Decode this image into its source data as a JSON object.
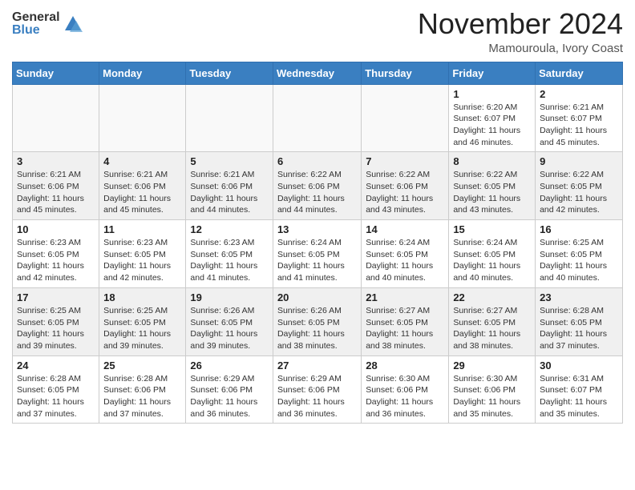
{
  "logo": {
    "general": "General",
    "blue": "Blue"
  },
  "title": "November 2024",
  "location": "Mamouroula, Ivory Coast",
  "headers": [
    "Sunday",
    "Monday",
    "Tuesday",
    "Wednesday",
    "Thursday",
    "Friday",
    "Saturday"
  ],
  "weeks": [
    [
      {
        "day": "",
        "info": ""
      },
      {
        "day": "",
        "info": ""
      },
      {
        "day": "",
        "info": ""
      },
      {
        "day": "",
        "info": ""
      },
      {
        "day": "",
        "info": ""
      },
      {
        "day": "1",
        "info": "Sunrise: 6:20 AM\nSunset: 6:07 PM\nDaylight: 11 hours\nand 46 minutes."
      },
      {
        "day": "2",
        "info": "Sunrise: 6:21 AM\nSunset: 6:07 PM\nDaylight: 11 hours\nand 45 minutes."
      }
    ],
    [
      {
        "day": "3",
        "info": "Sunrise: 6:21 AM\nSunset: 6:06 PM\nDaylight: 11 hours\nand 45 minutes."
      },
      {
        "day": "4",
        "info": "Sunrise: 6:21 AM\nSunset: 6:06 PM\nDaylight: 11 hours\nand 45 minutes."
      },
      {
        "day": "5",
        "info": "Sunrise: 6:21 AM\nSunset: 6:06 PM\nDaylight: 11 hours\nand 44 minutes."
      },
      {
        "day": "6",
        "info": "Sunrise: 6:22 AM\nSunset: 6:06 PM\nDaylight: 11 hours\nand 44 minutes."
      },
      {
        "day": "7",
        "info": "Sunrise: 6:22 AM\nSunset: 6:06 PM\nDaylight: 11 hours\nand 43 minutes."
      },
      {
        "day": "8",
        "info": "Sunrise: 6:22 AM\nSunset: 6:05 PM\nDaylight: 11 hours\nand 43 minutes."
      },
      {
        "day": "9",
        "info": "Sunrise: 6:22 AM\nSunset: 6:05 PM\nDaylight: 11 hours\nand 42 minutes."
      }
    ],
    [
      {
        "day": "10",
        "info": "Sunrise: 6:23 AM\nSunset: 6:05 PM\nDaylight: 11 hours\nand 42 minutes."
      },
      {
        "day": "11",
        "info": "Sunrise: 6:23 AM\nSunset: 6:05 PM\nDaylight: 11 hours\nand 42 minutes."
      },
      {
        "day": "12",
        "info": "Sunrise: 6:23 AM\nSunset: 6:05 PM\nDaylight: 11 hours\nand 41 minutes."
      },
      {
        "day": "13",
        "info": "Sunrise: 6:24 AM\nSunset: 6:05 PM\nDaylight: 11 hours\nand 41 minutes."
      },
      {
        "day": "14",
        "info": "Sunrise: 6:24 AM\nSunset: 6:05 PM\nDaylight: 11 hours\nand 40 minutes."
      },
      {
        "day": "15",
        "info": "Sunrise: 6:24 AM\nSunset: 6:05 PM\nDaylight: 11 hours\nand 40 minutes."
      },
      {
        "day": "16",
        "info": "Sunrise: 6:25 AM\nSunset: 6:05 PM\nDaylight: 11 hours\nand 40 minutes."
      }
    ],
    [
      {
        "day": "17",
        "info": "Sunrise: 6:25 AM\nSunset: 6:05 PM\nDaylight: 11 hours\nand 39 minutes."
      },
      {
        "day": "18",
        "info": "Sunrise: 6:25 AM\nSunset: 6:05 PM\nDaylight: 11 hours\nand 39 minutes."
      },
      {
        "day": "19",
        "info": "Sunrise: 6:26 AM\nSunset: 6:05 PM\nDaylight: 11 hours\nand 39 minutes."
      },
      {
        "day": "20",
        "info": "Sunrise: 6:26 AM\nSunset: 6:05 PM\nDaylight: 11 hours\nand 38 minutes."
      },
      {
        "day": "21",
        "info": "Sunrise: 6:27 AM\nSunset: 6:05 PM\nDaylight: 11 hours\nand 38 minutes."
      },
      {
        "day": "22",
        "info": "Sunrise: 6:27 AM\nSunset: 6:05 PM\nDaylight: 11 hours\nand 38 minutes."
      },
      {
        "day": "23",
        "info": "Sunrise: 6:28 AM\nSunset: 6:05 PM\nDaylight: 11 hours\nand 37 minutes."
      }
    ],
    [
      {
        "day": "24",
        "info": "Sunrise: 6:28 AM\nSunset: 6:05 PM\nDaylight: 11 hours\nand 37 minutes."
      },
      {
        "day": "25",
        "info": "Sunrise: 6:28 AM\nSunset: 6:06 PM\nDaylight: 11 hours\nand 37 minutes."
      },
      {
        "day": "26",
        "info": "Sunrise: 6:29 AM\nSunset: 6:06 PM\nDaylight: 11 hours\nand 36 minutes."
      },
      {
        "day": "27",
        "info": "Sunrise: 6:29 AM\nSunset: 6:06 PM\nDaylight: 11 hours\nand 36 minutes."
      },
      {
        "day": "28",
        "info": "Sunrise: 6:30 AM\nSunset: 6:06 PM\nDaylight: 11 hours\nand 36 minutes."
      },
      {
        "day": "29",
        "info": "Sunrise: 6:30 AM\nSunset: 6:06 PM\nDaylight: 11 hours\nand 35 minutes."
      },
      {
        "day": "30",
        "info": "Sunrise: 6:31 AM\nSunset: 6:07 PM\nDaylight: 11 hours\nand 35 minutes."
      }
    ]
  ]
}
